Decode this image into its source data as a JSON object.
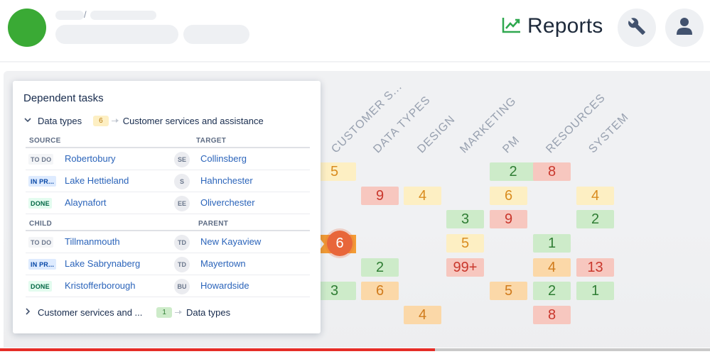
{
  "header": {
    "reports_label": "Reports",
    "breadcrumb_separator": "/",
    "accent_color": "#3aaa35"
  },
  "icons": {
    "logo": "green-circle-logo",
    "reports": "chart-line-icon",
    "settings": "wrench-icon",
    "profile": "user-icon"
  },
  "board": {
    "columns": [
      "CUSTOMER S...",
      "DATA TYPES",
      "DESIGN",
      "MARKETING",
      "PM",
      "RESOURCES",
      "SYSTEM"
    ],
    "cells": [
      {
        "value": "5",
        "color": "yellow"
      },
      {
        "value": "2",
        "color": "green"
      },
      {
        "value": "8",
        "color": "red"
      },
      {
        "value": "9",
        "color": "red"
      },
      {
        "value": "4",
        "color": "yellow"
      },
      {
        "value": "6",
        "color": "yellow"
      },
      {
        "value": "4",
        "color": "yellow"
      },
      {
        "value": "3",
        "color": "green"
      },
      {
        "value": "9",
        "color": "red"
      },
      {
        "value": "2",
        "color": "green"
      },
      {
        "value": "5",
        "color": "yellow"
      },
      {
        "value": "1",
        "color": "green"
      },
      {
        "value": "2",
        "color": "green"
      },
      {
        "value": "99+",
        "color": "red"
      },
      {
        "value": "4",
        "color": "orange"
      },
      {
        "value": "13",
        "color": "red"
      },
      {
        "value": "3",
        "color": "green"
      },
      {
        "value": "6",
        "color": "orange"
      },
      {
        "value": "5",
        "color": "orange"
      },
      {
        "value": "2",
        "color": "green"
      },
      {
        "value": "1",
        "color": "green"
      },
      {
        "value": "4",
        "color": "orange"
      },
      {
        "value": "8",
        "color": "red"
      }
    ],
    "selected_value": "6"
  },
  "panel": {
    "title": "Dependent tasks",
    "group1": {
      "source": "Data types",
      "count": "6",
      "target": "Customer services and assistance"
    },
    "head1": {
      "left": "SOURCE",
      "right": "TARGET"
    },
    "rows1": [
      {
        "status": "TO DO",
        "source": "Robertobury",
        "avatar": "SE",
        "target": "Collinsberg"
      },
      {
        "status": "IN PR...",
        "source": "Lake Hettieland",
        "avatar": "S",
        "target": "Hahnchester"
      },
      {
        "status": "DONE",
        "source": "Alaynafort",
        "avatar": "EE",
        "target": "Oliverchester"
      }
    ],
    "head2": {
      "left": "CHILD",
      "right": "PARENT"
    },
    "rows2": [
      {
        "status": "TO DO",
        "source": "Tillmanmouth",
        "avatar": "TD",
        "target": "New Kayaview"
      },
      {
        "status": "IN PR...",
        "source": "Lake Sabrynaberg",
        "avatar": "TD",
        "target": "Mayertown"
      },
      {
        "status": "DONE",
        "source": "Kristofferborough",
        "avatar": "BU",
        "target": "Howardside"
      }
    ],
    "group2": {
      "source": "Customer services and ...",
      "count": "1",
      "target": "Data types"
    }
  },
  "video": {
    "progress_fraction": 0.613,
    "progress_color": "#e52d27"
  }
}
